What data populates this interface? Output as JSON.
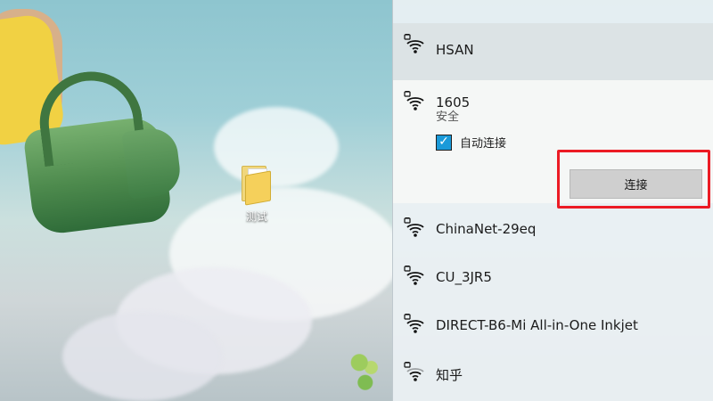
{
  "desktop": {
    "icon_label": "测试"
  },
  "wifi_panel": {
    "networks": [
      {
        "name": "HSAN"
      },
      {
        "name": "1605",
        "status": "安全",
        "auto_connect_label": "自动连接",
        "connect_label": "连接"
      },
      {
        "name": "ChinaNet-29eq"
      },
      {
        "name": "CU_3JR5"
      },
      {
        "name": "DIRECT-B6-Mi All-in-One Inkjet"
      },
      {
        "name": "知乎"
      }
    ]
  },
  "colors": {
    "accent": "#1a9ad9",
    "highlight": "#ec1b24"
  },
  "icons": {
    "network": "wifi-lock-icon",
    "desktop_item": "folder-icon",
    "checkbox": "checkbox-icon"
  }
}
